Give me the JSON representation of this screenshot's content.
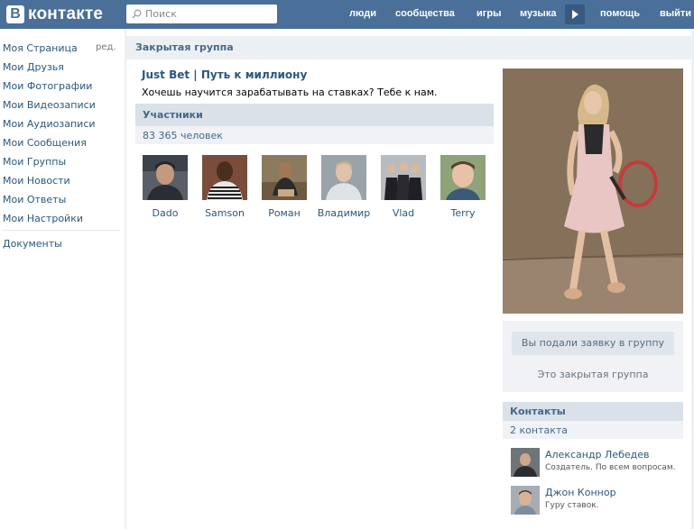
{
  "header": {
    "logo_letter": "В",
    "logo_text": "контакте",
    "search_placeholder": "Поиск",
    "nav": [
      "люди",
      "сообщества",
      "игры",
      "музыка",
      "помощь",
      "выйти"
    ]
  },
  "sidebar": {
    "edit_label": "ред.",
    "items": [
      {
        "label": "Моя Страница"
      },
      {
        "label": "Мои Друзья"
      },
      {
        "label": "Мои Фотографии"
      },
      {
        "label": "Мои Видеозаписи"
      },
      {
        "label": "Мои Аудиозаписи"
      },
      {
        "label": "Мои Сообщения"
      },
      {
        "label": "Мои Группы"
      },
      {
        "label": "Мои Новости"
      },
      {
        "label": "Мои Ответы"
      },
      {
        "label": "Мои Настройки"
      }
    ],
    "extra": "Документы"
  },
  "group": {
    "type_label": "Закрытая группа",
    "title": "Just Bet  |  Путь к миллиону",
    "description": "Хочешь научится зарабатывать на ставках? Тебе к нам."
  },
  "members": {
    "heading": "Участники",
    "count": "83 365 человек",
    "list": [
      {
        "name": "Dado"
      },
      {
        "name": "Samson"
      },
      {
        "name": "Роман"
      },
      {
        "name": "Владимир"
      },
      {
        "name": "Vlad"
      },
      {
        "name": "Terry"
      }
    ]
  },
  "join": {
    "button_label": "Вы подали заявку в группу",
    "note": "Это закрытая группа"
  },
  "contacts": {
    "heading": "Контакты",
    "count": "2 контакта",
    "list": [
      {
        "name": "Александр Лебедев",
        "role": "Создатель. По всем вопросам."
      },
      {
        "name": "Джон Коннор",
        "role": "Гуру ставок."
      }
    ]
  },
  "colors": {
    "topbar": "#4a6f98",
    "link": "#2b587a",
    "section_header": "#dae1e8",
    "panel_bg": "#f0f2f5"
  }
}
